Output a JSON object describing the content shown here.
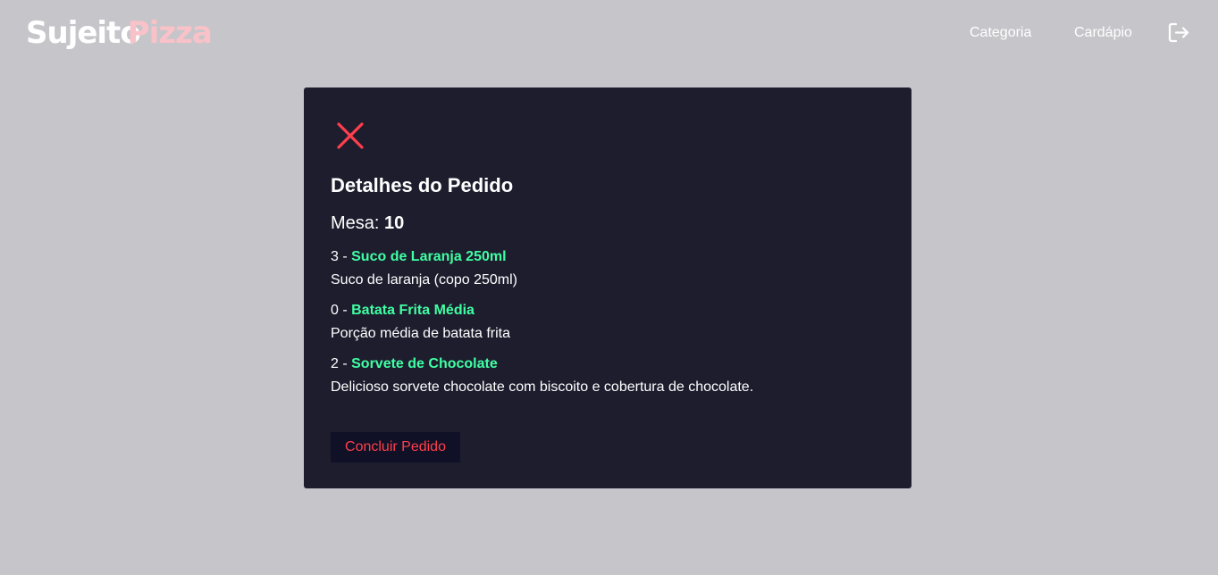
{
  "header": {
    "logo_part1": "Sujeito",
    "logo_part2": "Pizza",
    "nav": [
      {
        "label": "Categoria"
      },
      {
        "label": "Cardápio"
      }
    ],
    "logout_icon": "logout-icon"
  },
  "modal": {
    "close_icon": "close-icon",
    "title": "Detalhes do Pedido",
    "table_label": "Mesa:",
    "table_number": "10",
    "items": [
      {
        "quantity": "3",
        "separator": " - ",
        "name": "Suco de Laranja 250ml",
        "description": "Suco de laranja (copo 250ml)"
      },
      {
        "quantity": "0",
        "separator": " - ",
        "name": "Batata Frita Média",
        "description": "Porção média de batata frita"
      },
      {
        "quantity": "2",
        "separator": " - ",
        "name": "Sorvete de Chocolate",
        "description": "Delicioso sorvete chocolate com biscoito e cobertura de chocolate."
      }
    ],
    "finish_label": "Concluir Pedido"
  },
  "colors": {
    "page_background": "#c6c5ca",
    "modal_background": "#1d1d2e",
    "accent_red": "#ff3f4b",
    "accent_green": "#3fffa3",
    "logo_pink": "#f8c2c8"
  }
}
